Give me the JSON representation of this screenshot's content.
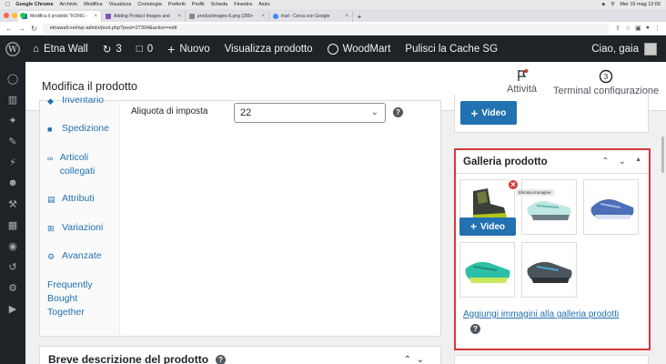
{
  "mac": {
    "app": "Google Chrome",
    "menus": [
      "Archivio",
      "Modifica",
      "Visualizza",
      "Cronologia",
      "Preferiti",
      "Profili",
      "Scheda",
      "Finestra",
      "Aiuto"
    ],
    "clock": "Mer 15 mag  12:00"
  },
  "browser": {
    "tabs": [
      {
        "title": "Modifica il prodotto \"KONG -",
        "color": "#2271b1"
      },
      {
        "title": "Adding Product Images and",
        "color": "#7f54b3"
      },
      {
        "title": "productimages-6.png (285×",
        "color": "#888888"
      },
      {
        "title": "trad - Cerca con Google",
        "color": "#4285f4"
      }
    ],
    "new_tab": "+",
    "url": "etnawall.net/wp-admin/post.php?post=27304&action=edit"
  },
  "adminbar": {
    "site": "Etna Wall",
    "updates": "3",
    "comments": "0",
    "new": "Nuovo",
    "view": "Visualizza prodotto",
    "woodmart": "WoodMart",
    "cache": "Pulisci la Cache SG",
    "greeting": "Ciao, gaia"
  },
  "header": {
    "title": "Modifica il prodotto",
    "activity": "Attività",
    "setup": "Terminal configurazione",
    "setup_count": "3"
  },
  "product_data": {
    "tabs": [
      {
        "label": "Inventario",
        "icon": "inventory-icon"
      },
      {
        "label": "Spedizione",
        "icon": "truck-icon"
      },
      {
        "label": "Articoli collegati",
        "icon": "link-icon"
      },
      {
        "label": "Attributi",
        "icon": "list-icon"
      },
      {
        "label": "Variazioni",
        "icon": "grid-icon"
      },
      {
        "label": "Avanzate",
        "icon": "gear-icon"
      },
      {
        "label": "Frequently Bought Together",
        "icon": ""
      }
    ],
    "tax_label": "Aliquota di imposta",
    "tax_value": "22"
  },
  "short_description": {
    "title": "Breve descrizione del prodotto"
  },
  "video_label": "Video",
  "gallery": {
    "title": "Galleria prodotto",
    "delete_tooltip": "Elimina immagine",
    "add_link": "Aggiungi immagini alla galleria prodotti"
  }
}
